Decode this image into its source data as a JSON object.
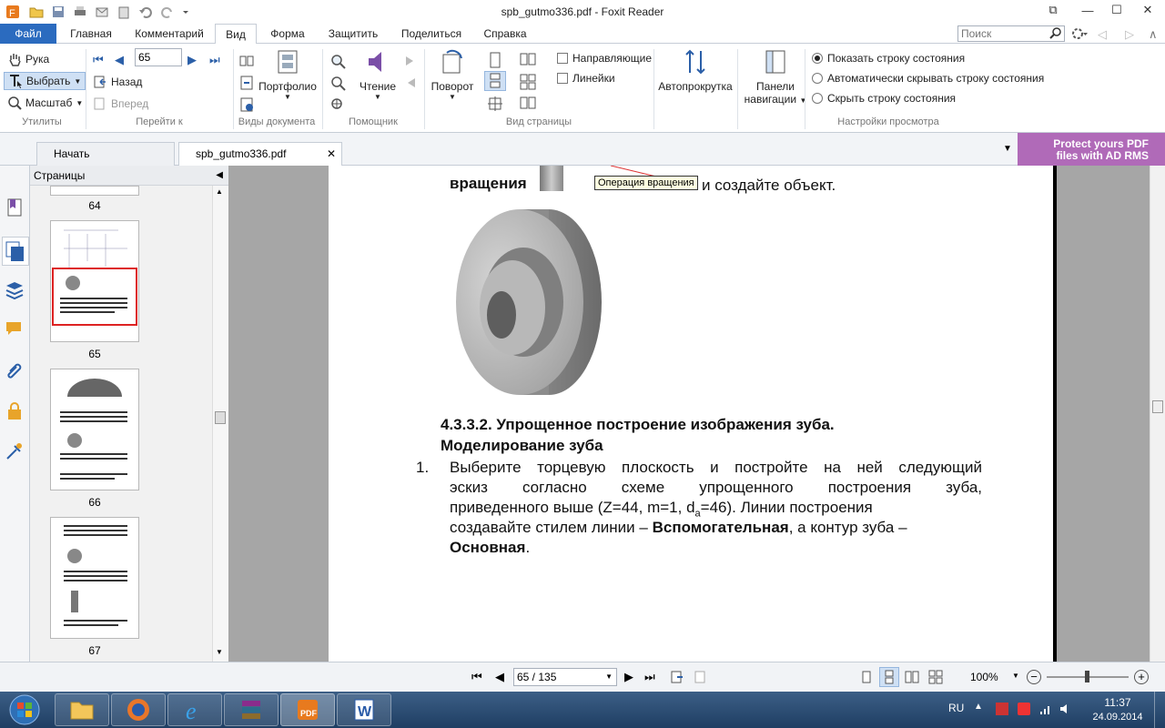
{
  "window": {
    "title": "spb_gutmo336.pdf - Foxit Reader"
  },
  "menu_tabs": [
    "Файл",
    "Главная",
    "Комментарий",
    "Вид",
    "Форма",
    "Защитить",
    "Поделиться",
    "Справка"
  ],
  "search": {
    "placeholder": "Поиск"
  },
  "ribbon": {
    "utilities": {
      "hand": "Рука",
      "select": "Выбрать",
      "zoom": "Масштаб",
      "group": "Утилиты"
    },
    "goto": {
      "page_value": "65",
      "back": "Назад",
      "forward": "Вперед",
      "group": "Перейти к"
    },
    "docviews": {
      "portfolio": "Портфолио",
      "group": "Виды документа"
    },
    "assistant": {
      "read": "Чтение",
      "group": "Помощник"
    },
    "pageview": {
      "rotate": "Поворот",
      "guides": "Направляющие",
      "rulers": "Линейки",
      "group": "Вид страницы"
    },
    "autoscroll": "Автопрокрутка",
    "navpanels": {
      "line1": "Панели",
      "line2": "навигации"
    },
    "viewsettings": {
      "opt1": "Показать строку состояния",
      "opt2": "Автоматически скрывать строку состояния",
      "opt3": "Скрыть строку состояния",
      "group": "Настройки просмотра"
    }
  },
  "doc_tabs": {
    "start": "Начать",
    "file": "spb_gutmo336.pdf"
  },
  "rms": {
    "line1": "Protect yours PDF",
    "line2": "files with AD RMS"
  },
  "pages_panel": {
    "title": "Страницы",
    "pages": [
      "64",
      "65",
      "66",
      "67"
    ]
  },
  "document": {
    "top_word": "вращения",
    "tooltip": "Операция вращения",
    "top_rest": "и создайте объект.",
    "heading1": "4.3.3.2. Упрощенное построение изображения зуба.",
    "heading2": "Моделирование зуба",
    "item_num": "1.",
    "lines": [
      "Выберите торцевую плоскость и постройте на ней следующий",
      "эскиз согласно схеме упрощенного построения зуба,",
      "приведенного выше (Z=44, m=1, d",
      "a",
      "=46). Линии построения",
      "создавайте стилем линии –",
      "Вспомогательная",
      ", а контур зуба –",
      "Основная",
      "."
    ]
  },
  "status": {
    "page": "65 / 135",
    "zoom": "100%"
  },
  "taskbar": {
    "lang": "RU",
    "time": "11:37",
    "date": "24.09.2014"
  }
}
